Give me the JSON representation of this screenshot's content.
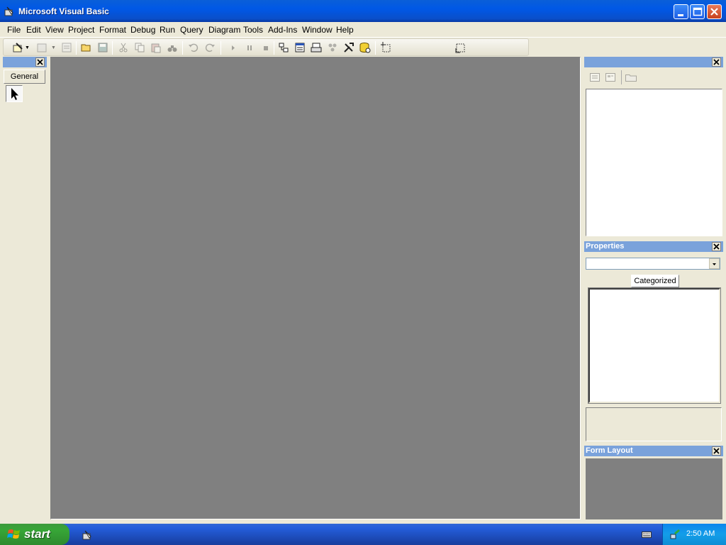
{
  "window": {
    "title": "Microsoft Visual Basic"
  },
  "menu": [
    {
      "label": "File"
    },
    {
      "label": "Edit"
    },
    {
      "label": "View"
    },
    {
      "label": "Project"
    },
    {
      "label": "Format"
    },
    {
      "label": "Debug"
    },
    {
      "label": "Run"
    },
    {
      "label": "Query"
    },
    {
      "label": "Diagram"
    },
    {
      "label": "Tools"
    },
    {
      "label": "Add-Ins"
    },
    {
      "label": "Window"
    },
    {
      "label": "Help"
    }
  ],
  "toolbar": {
    "icons": [
      "add-project-icon",
      "add-form-icon",
      "menu-editor-icon",
      "open-project-icon",
      "save-project-icon",
      "cut-icon",
      "copy-icon",
      "paste-icon",
      "find-icon",
      "undo-icon",
      "redo-icon",
      "start-icon",
      "break-icon",
      "end-icon",
      "project-explorer-icon",
      "properties-window-icon",
      "form-layout-icon",
      "object-browser-icon",
      "toolbox-icon",
      "data-view-icon",
      "component-manager-icon",
      "position-icon"
    ]
  },
  "toolbox": {
    "tab_label": "General",
    "pointer_icon": "pointer-icon"
  },
  "project_pane": {
    "title": ""
  },
  "properties": {
    "title": "Properties",
    "object_value": "",
    "tab_label": "Categorized"
  },
  "form_layout": {
    "title": "Form Layout"
  },
  "taskbar": {
    "start_label": "start",
    "clock": "2:50 AM"
  },
  "colors": {
    "title_blue": "#0058e6",
    "pane_head": "#7aa2db",
    "mdi_gray": "#808080",
    "start_green": "#37a637"
  }
}
